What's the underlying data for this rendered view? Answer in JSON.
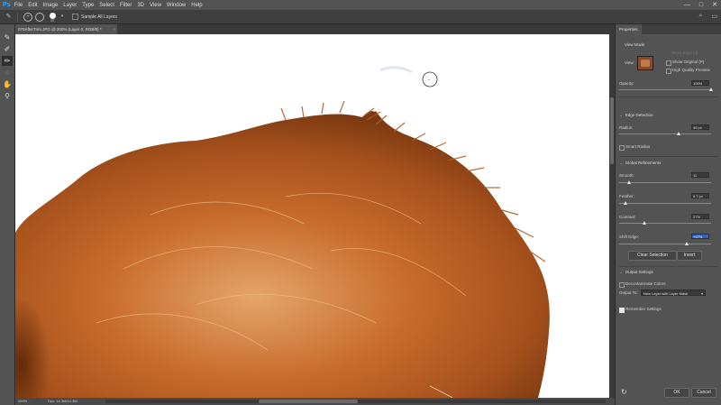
{
  "app": {
    "logo": "Ps"
  },
  "menu": [
    "File",
    "Edit",
    "Image",
    "Layer",
    "Type",
    "Select",
    "Filter",
    "3D",
    "View",
    "Window",
    "Help"
  ],
  "window_controls": {
    "minimize": "—",
    "maximize": "□",
    "close": "✕"
  },
  "options_bar": {
    "brush_size": "20",
    "sample_all_layers": "Sample All Layers"
  },
  "document": {
    "tab_title": "070AfterTrim.JPG @ 200% (Layer 0, RGB/8) *",
    "close": "×"
  },
  "status": {
    "zoom": "200%",
    "doc": "Doc: 14.3M/14.3M"
  },
  "panel": {
    "tab": "Properties",
    "view_mode": {
      "heading": "View Mode",
      "view_label": "View:",
      "show_edge": "Show Edge (J)",
      "show_original": "Show Original (P)",
      "high_quality": "High Quality Preview"
    },
    "opacity": {
      "label": "Opacity:",
      "value": "100%",
      "fraction": 1.0
    },
    "edge_detection": {
      "heading": "Edge Detection",
      "radius_label": "Radius:",
      "radius_value": "45 px",
      "radius_fraction": 0.65,
      "smart_radius": "Smart Radius"
    },
    "global_refinements": {
      "heading": "Global Refinements",
      "smooth": {
        "label": "Smooth:",
        "value": "11",
        "fraction": 0.11
      },
      "feather": {
        "label": "Feather:",
        "value": "6.7 px",
        "fraction": 0.07
      },
      "contrast": {
        "label": "Contrast:",
        "value": "27%",
        "fraction": 0.27
      },
      "shift_edge": {
        "label": "Shift Edge:",
        "value": "+47%",
        "fraction": 0.735
      }
    },
    "buttons": {
      "clear_selection": "Clear Selection",
      "invert": "Invert"
    },
    "output": {
      "heading": "Output Settings",
      "decontaminate": "Decontaminate Colors",
      "output_to_label": "Output To:",
      "output_to_value": "New Layer with Layer Mask",
      "remember": "Remember Settings"
    },
    "footer": {
      "ok": "OK",
      "cancel": "Cancel"
    }
  }
}
